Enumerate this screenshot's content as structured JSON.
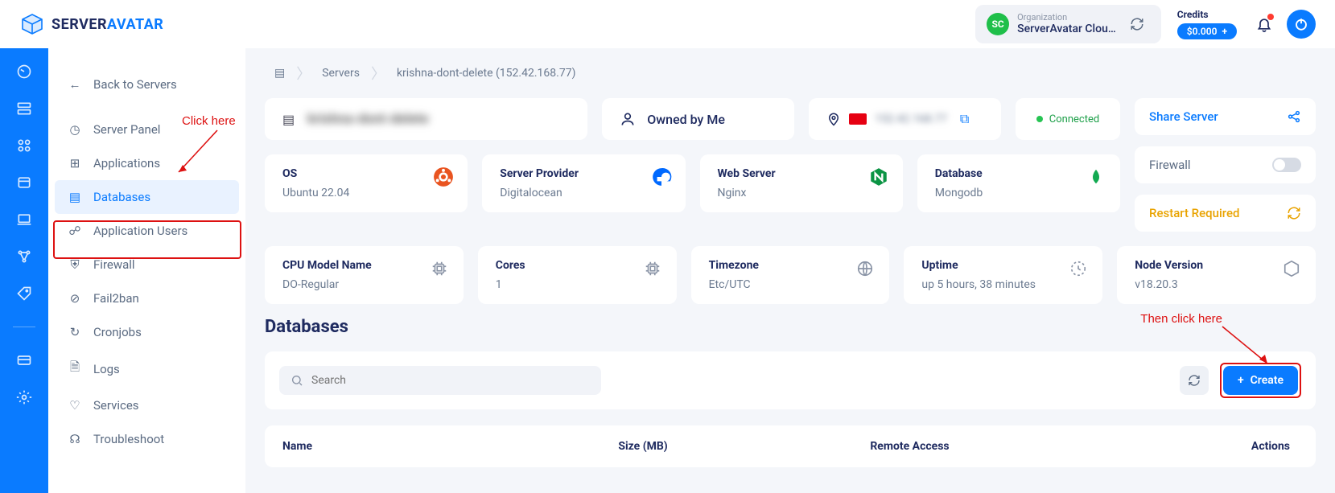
{
  "brand": {
    "part1": "SERVER",
    "part2": "AVATAR"
  },
  "topbar": {
    "org_label": "Organization",
    "org_name": "ServerAvatar Clou…",
    "org_initials": "SC",
    "credits_label": "Credits",
    "credits_value": "$0.000"
  },
  "sidebar": {
    "back": "Back to Servers",
    "items": [
      {
        "label": "Server Panel",
        "icon": "gauge"
      },
      {
        "label": "Applications",
        "icon": "apps"
      },
      {
        "label": "Databases",
        "icon": "db",
        "active": true
      },
      {
        "label": "Application Users",
        "icon": "users"
      },
      {
        "label": "Firewall",
        "icon": "shield"
      },
      {
        "label": "Fail2ban",
        "icon": "ban"
      },
      {
        "label": "Cronjobs",
        "icon": "refresh"
      },
      {
        "label": "Logs",
        "icon": "file"
      },
      {
        "label": "Services",
        "icon": "heart"
      },
      {
        "label": "Troubleshoot",
        "icon": "headset"
      }
    ]
  },
  "breadcrumb": {
    "level1": "Servers",
    "level2": "krishna-dont-delete (152.42.168.77)"
  },
  "server": {
    "name": "krishna-dont-delete",
    "owned_by": "Owned by Me",
    "ip": "152.42.168.77",
    "status": "Connected"
  },
  "info_cards": [
    {
      "title": "OS",
      "value": "Ubuntu 22.04",
      "icon": "ubuntu"
    },
    {
      "title": "Server Provider",
      "value": "Digitalocean",
      "icon": "do"
    },
    {
      "title": "Web Server",
      "value": "Nginx",
      "icon": "nginx"
    },
    {
      "title": "Database",
      "value": "Mongodb",
      "icon": "mongo"
    }
  ],
  "stat_cards": [
    {
      "title": "CPU Model Name",
      "value": "DO-Regular",
      "icon": "cpu"
    },
    {
      "title": "Cores",
      "value": "1",
      "icon": "cpu"
    },
    {
      "title": "Timezone",
      "value": "Etc/UTC",
      "icon": "globe"
    },
    {
      "title": "Uptime",
      "value": "up 5 hours, 38 minutes",
      "icon": "clock"
    },
    {
      "title": "Node Version",
      "value": "v18.20.3",
      "icon": "node"
    }
  ],
  "actions": {
    "share": "Share Server",
    "firewall": "Firewall",
    "restart": "Restart Required"
  },
  "databases": {
    "heading": "Databases",
    "search_placeholder": "Search",
    "create": "Create",
    "columns": {
      "name": "Name",
      "size": "Size (MB)",
      "remote": "Remote Access",
      "actions": "Actions"
    }
  },
  "annotations": {
    "a1": "Click here",
    "a2": "Then click here"
  }
}
